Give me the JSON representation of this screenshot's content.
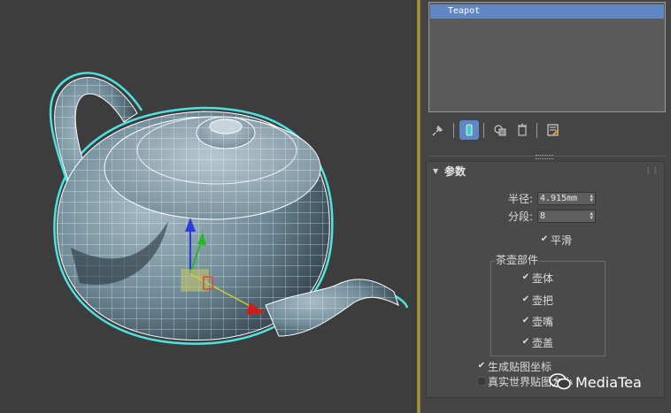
{
  "selection_list": {
    "items": [
      "Teapot"
    ]
  },
  "toolbar": {
    "buttons": [
      {
        "icon": "pin-icon"
      },
      {
        "icon": "modifier-stack-icon",
        "active": true
      },
      {
        "icon": "make-unique-icon"
      },
      {
        "icon": "trash-icon"
      },
      {
        "icon": "configure-sets-icon"
      }
    ]
  },
  "parameters": {
    "title": "参数",
    "radius_label": "半径:",
    "radius_value": "4.915mm",
    "segments_label": "分段:",
    "segments_value": "8",
    "smooth_label": "平滑",
    "teapot_parts": {
      "title": "茶壶部件",
      "body": "壶体",
      "handle": "壶把",
      "spout": "壶嘴",
      "lid": "壶盖"
    },
    "gen_mapping_coords": "生成贴图坐标",
    "real_world_map_size": "真实世界贴图大小"
  },
  "watermark": {
    "text": "MediaTea"
  },
  "colors": {
    "selection": "#5e87c4",
    "wireframe": "#ffffff",
    "selection_outline": "#4de3e3"
  }
}
